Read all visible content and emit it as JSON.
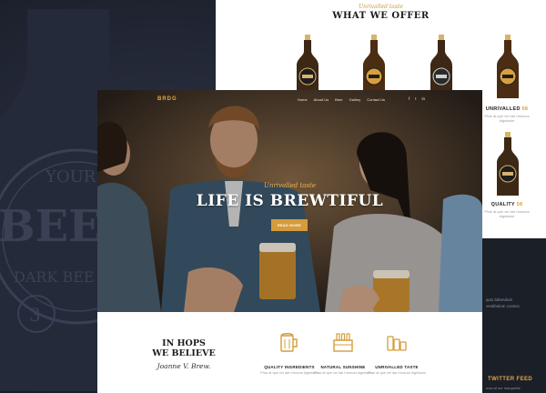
{
  "background": {
    "bottle_label_lines": [
      "YOUR TA",
      "BEE",
      "DARK BEE",
      "3"
    ]
  },
  "offer": {
    "eyebrow": "Unrivalled taste",
    "title": "WHAT WE OFFER",
    "side_items": [
      {
        "name": "UNRIVALLED",
        "num": "58",
        "desc": "Phar at que vel dar rhoncus dignissim"
      },
      {
        "name": "QUALITY",
        "num": "58",
        "desc": "Phar at que vel dar rhoncus dignissim"
      }
    ]
  },
  "right_panel": {
    "lines": [
      "quis bibendum",
      "vestibulum consec"
    ],
    "twitter_title": "TWITTER FEED",
    "twitter_sub": "now at our marquette"
  },
  "nav": {
    "logo": "BRDG",
    "items": [
      "Home",
      "About Us",
      "Beer",
      "Gallery",
      "Contact Us"
    ],
    "social": [
      "f",
      "t",
      "in"
    ]
  },
  "hero": {
    "eyebrow": "Unrivalled taste",
    "title": "LIFE IS BREWTIFUL",
    "button": "READ MORE"
  },
  "believe": {
    "line1": "IN HOPS",
    "line2": "WE BELIEVE",
    "signature": "Joanne V. Brew."
  },
  "features": [
    {
      "icon": "beer-mug-icon",
      "title": "QUALITY INGREDIENTS",
      "desc": "Phar at que vel dar rhoncus dignissim"
    },
    {
      "icon": "beer-crate-icon",
      "title": "NATURAL SUNSHINE",
      "desc": "Phar at que vel dar rhoncus dignissim"
    },
    {
      "icon": "beer-cans-icon",
      "title": "UNRIVALLED TASTE",
      "desc": "Phar at que vel dar rhoncus dignissim"
    }
  ],
  "colors": {
    "accent": "#d59c3c",
    "dark": "#1d2230"
  }
}
